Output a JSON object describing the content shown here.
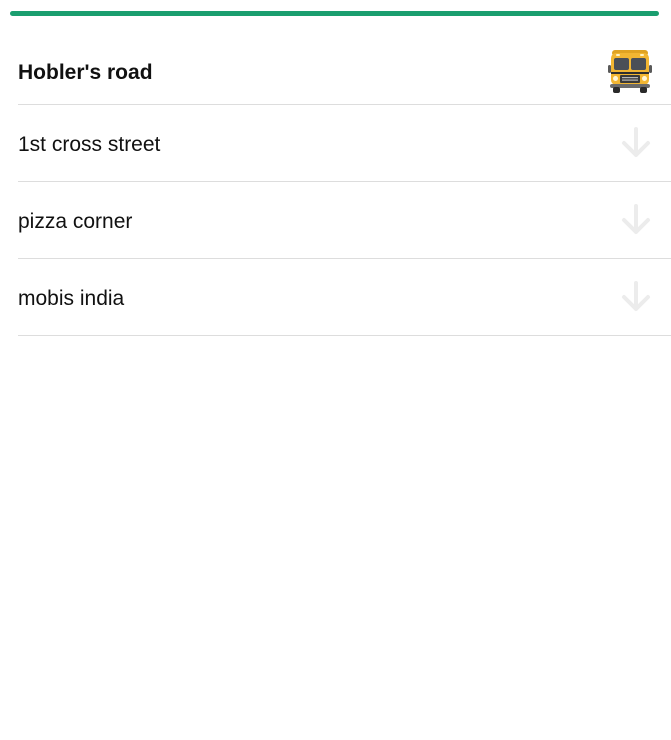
{
  "colors": {
    "accent": "#1a9e6f",
    "arrow": "#ececec",
    "bus_body": "#f2b632"
  },
  "route": {
    "current_stop": "Hobler's road",
    "current_icon": "bus-icon",
    "next_stop_icon": "arrow-down-icon",
    "stops": [
      {
        "label": "1st cross street"
      },
      {
        "label": "pizza corner"
      },
      {
        "label": "mobis india"
      }
    ]
  }
}
